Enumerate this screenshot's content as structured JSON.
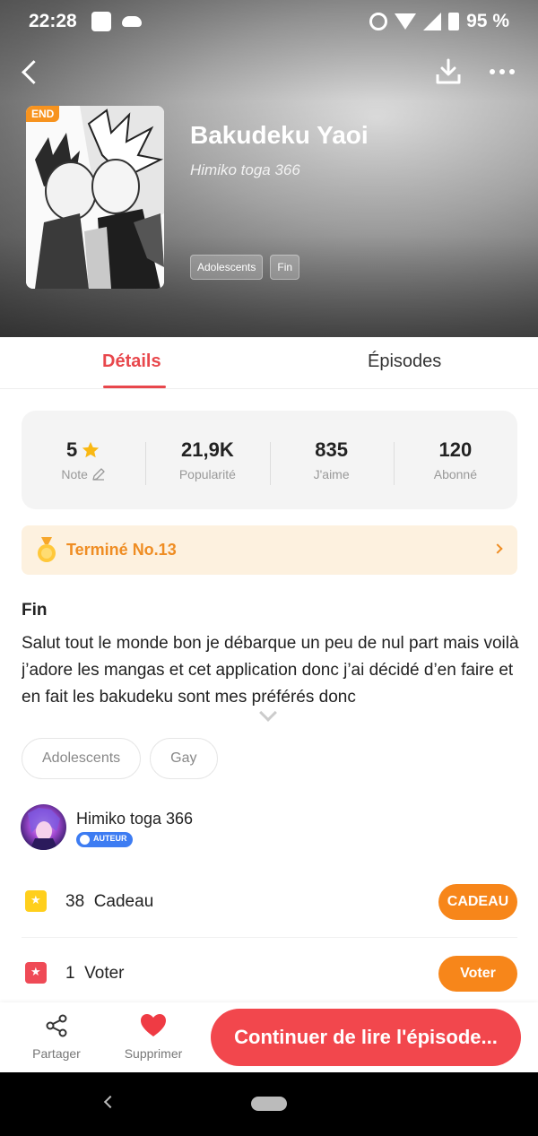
{
  "status_bar": {
    "time": "22:28",
    "battery": "95 %"
  },
  "book": {
    "badge": "END",
    "title": "Bakudeku Yaoi",
    "author": "Himiko toga 366",
    "tags": [
      "Adolescents",
      "Fin"
    ]
  },
  "tabs": {
    "details": "Détails",
    "episodes": "Épisodes"
  },
  "stats": [
    {
      "value": "5",
      "label": "Note"
    },
    {
      "value": "21,9K",
      "label": "Popularité"
    },
    {
      "value": "835",
      "label": "J'aime"
    },
    {
      "value": "120",
      "label": "Abonné"
    }
  ],
  "ranking": {
    "label": "Terminé No.13"
  },
  "description": {
    "title": "Fin",
    "body": "Salut tout le monde bon je débarque un peu de nul part mais voilà j’adore les mangas et cet application donc j’ai décidé d’en faire et en fait les bakudeku sont mes préférés donc"
  },
  "genres": [
    "Adolescents",
    "Gay"
  ],
  "author": {
    "name": "Himiko toga 366",
    "badge": "AUTEUR"
  },
  "gift": {
    "count": "38",
    "label": "Cadeau",
    "button": "CADEAU"
  },
  "vote": {
    "count": "1",
    "label": "Voter",
    "button": "Voter"
  },
  "actions": {
    "share": "Partager",
    "delete": "Supprimer",
    "continue": "Continuer de lire l'épisode..."
  },
  "colors": {
    "accent": "#e8474c",
    "orange": "#f7861a",
    "rank_bg": "#fdf1df",
    "rank_text": "#ef8d23"
  }
}
